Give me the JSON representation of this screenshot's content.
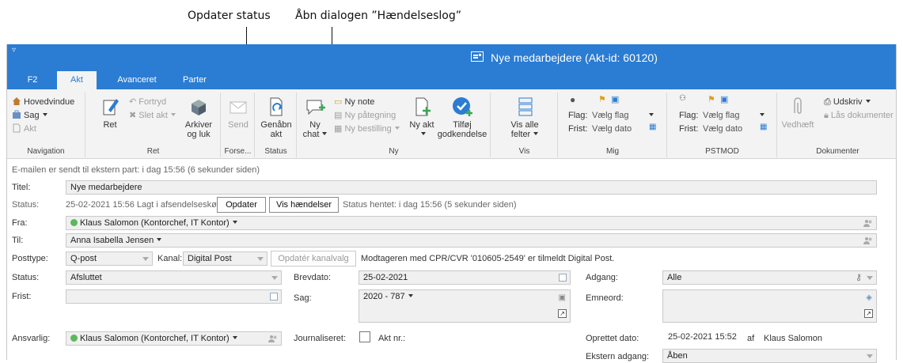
{
  "callouts": {
    "left": "Opdater status",
    "right": "Åbn dialogen ”Hændelseslog”"
  },
  "window": {
    "title": "Nye medarbejdere (Akt-id: 60120)",
    "qat": "▿"
  },
  "tabs": [
    "F2",
    "Akt",
    "Avanceret",
    "Parter"
  ],
  "ribbon": {
    "navigation": {
      "items": [
        "Hovedvindue",
        "Sag",
        "Akt"
      ],
      "label": "Navigation"
    },
    "ret": {
      "ret": "Ret",
      "fortryd": "Fortryd",
      "slet": "Slet akt",
      "arkiver": "Arkiver og luk",
      "label": "Ret"
    },
    "forsendelse": {
      "send": "Send",
      "label": "Forse..."
    },
    "status": {
      "genaabn": "Genåbn akt",
      "label": "Status"
    },
    "ny": {
      "ny_chat": "Ny chat",
      "ny_note": "Ny note",
      "ny_paategning": "Ny påtegning",
      "ny_bestilling": "Ny bestilling",
      "ny_akt": "Ny akt",
      "tilfoej": "Tilføj godkendelse",
      "label": "Ny"
    },
    "vis": {
      "vis_alle": "Vis alle felter",
      "label": "Vis"
    },
    "mig": {
      "flag_label": "Flag:",
      "flag_value": "Vælg flag",
      "frist_label": "Frist:",
      "frist_value": "Vælg dato",
      "label": "Mig"
    },
    "pstmod": {
      "flag_label": "Flag:",
      "flag_value": "Vælg flag",
      "frist_label": "Frist:",
      "frist_value": "Vælg dato",
      "label": "PSTMOD"
    },
    "dokumenter": {
      "vedhaeft": "Vedhæft",
      "udskriv": "Udskriv",
      "laas": "Lås dokumenter",
      "label": "Dokumenter"
    }
  },
  "form": {
    "info": "E-mailen er sendt til ekstern part:   i dag 15:56 (6 sekunder siden)",
    "titel_label": "Titel:",
    "titel_value": "Nye medarbejdere",
    "status_label": "Status:",
    "status_value": "25-02-2021 15:56 Lagt i afsendelseskø",
    "opdater_button": "Opdater",
    "vis_haendelser_button": "Vis hændelser",
    "status_hentet": "Status hentet: i dag 15:56 (5 sekunder siden)",
    "fra_label": "Fra:",
    "fra_value": "Klaus Salomon (Kontorchef, IT Kontor)",
    "til_label": "Til:",
    "til_value": "Anna Isabella Jensen",
    "posttype_label": "Posttype:",
    "posttype_value": "Q-post",
    "kanal_label": "Kanal:",
    "kanal_value": "Digital Post",
    "opdater_kanal_button": "Opdatér kanalvalg",
    "kanal_info": "Modtageren med CPR/CVR '010605-2549' er tilmeldt Digital Post.",
    "status2_label": "Status:",
    "status2_value": "Afsluttet",
    "brevdato_label": "Brevdato:",
    "brevdato_value": "25-02-2021",
    "adgang_label": "Adgang:",
    "adgang_value": "Alle",
    "frist_label": "Frist:",
    "frist_value": "",
    "sag_label": "Sag:",
    "sag_value": "2020 - 787",
    "emneord_label": "Emneord:",
    "ansvarlig_label": "Ansvarlig:",
    "ansvarlig_value": "Klaus Salomon (Kontorchef, IT Kontor)",
    "journaliseret_label": "Journaliseret:",
    "akt_nr_label": "Akt nr.:",
    "oprettet_label": "Oprettet dato:",
    "oprettet_value": "25-02-2021 15:52",
    "af_label": "af",
    "oprettet_af": "Klaus Salomon",
    "ekstern_label": "Ekstern adgang:",
    "ekstern_value": "Åben"
  }
}
